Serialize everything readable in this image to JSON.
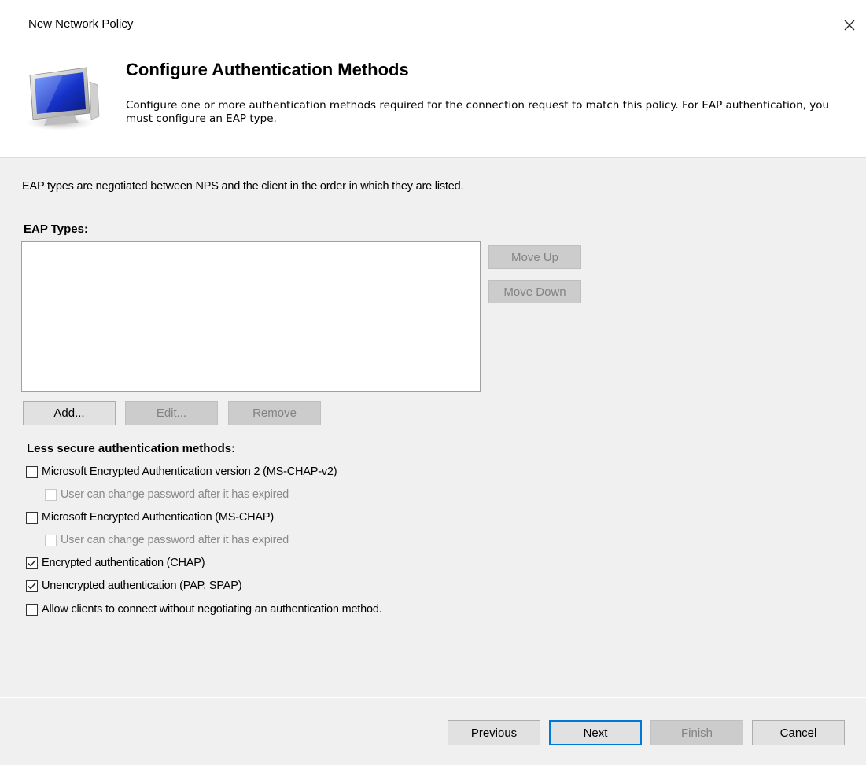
{
  "window": {
    "title": "New Network Policy",
    "close_icon": "close-icon"
  },
  "banner": {
    "heading": "Configure Authentication Methods",
    "description": "Configure one or more authentication methods required for the connection request to match this policy. For EAP authentication, you must configure an EAP type.",
    "icon": "monitor-icon"
  },
  "main": {
    "intro": "EAP types are negotiated between NPS and the client in the order in which they are listed.",
    "eap_types_label": "EAP Types:",
    "eap_types_items": [],
    "move_up_label": "Move Up",
    "move_down_label": "Move Down",
    "add_label": "Add...",
    "edit_label": "Edit...",
    "remove_label": "Remove",
    "less_secure_label": "Less secure authentication methods:",
    "options": [
      {
        "label": "Microsoft Encrypted Authentication version 2 (MS-CHAP-v2)",
        "checked": false,
        "enabled": true
      },
      {
        "label": "User can change password after it has expired",
        "checked": false,
        "enabled": false
      },
      {
        "label": "Microsoft Encrypted Authentication (MS-CHAP)",
        "checked": false,
        "enabled": true
      },
      {
        "label": "User can change password after it has expired",
        "checked": false,
        "enabled": false
      },
      {
        "label": "Encrypted authentication (CHAP)",
        "checked": true,
        "enabled": true
      },
      {
        "label": "Unencrypted authentication (PAP, SPAP)",
        "checked": true,
        "enabled": true
      },
      {
        "label": "Allow clients to connect without negotiating an authentication method.",
        "checked": false,
        "enabled": true
      }
    ]
  },
  "footer": {
    "previous_label": "Previous",
    "next_label": "Next",
    "finish_label": "Finish",
    "cancel_label": "Cancel"
  },
  "colors": {
    "panel_bg": "#f0f0f0",
    "button_bg": "#e1e1e1",
    "button_disabled_bg": "#cccccc",
    "disabled_text": "#838383",
    "accent": "#0078d7"
  }
}
